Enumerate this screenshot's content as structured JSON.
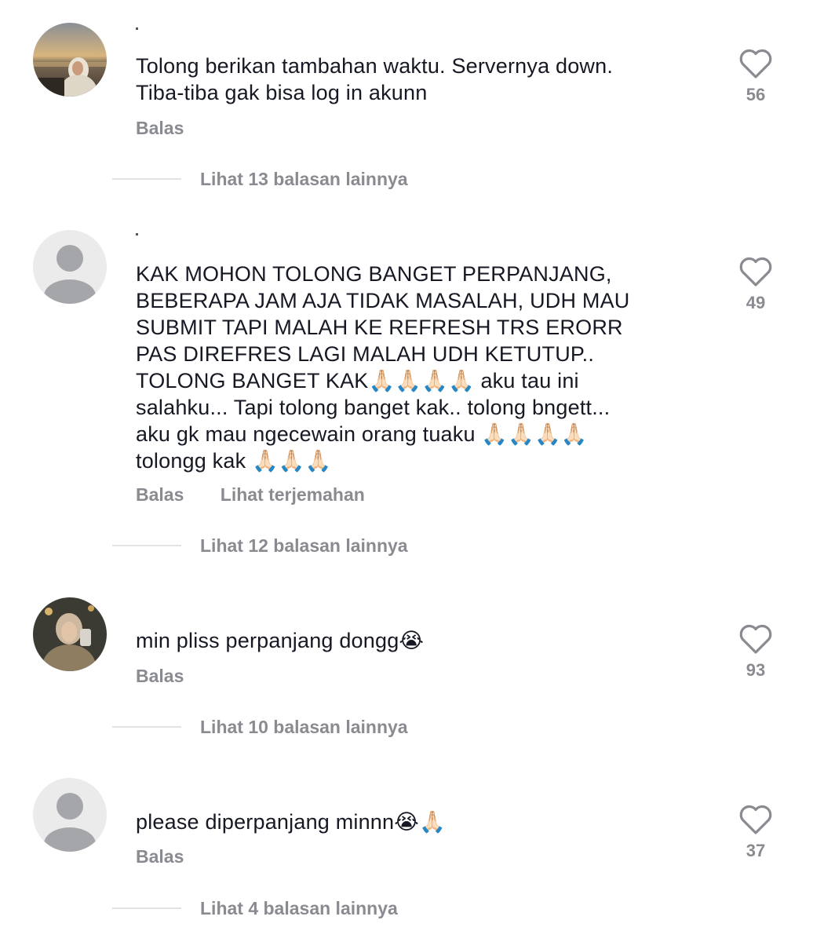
{
  "comments": [
    {
      "text": "Tolong berikan tambahan waktu. Servernya down.\nTiba-tiba gak bisa log in akunn",
      "likes": "56",
      "reply_label": "Balas",
      "more_replies": "Lihat 13 balasan lainnya",
      "avatar": "photo-beach"
    },
    {
      "text": "KAK MOHON TOLONG BANGET PERPANJANG,\nBEBERAPA JAM AJA TIDAK MASALAH, UDH MAU\nSUBMIT TAPI MALAH KE REFRESH TRS ERORR\nPAS DIREFRES LAGI MALAH UDH KETUTUP..\nTOLONG BANGET KAK🙏🏻🙏🏻🙏🏻🙏🏻 aku tau ini\nsalahku... Tapi tolong banget kak.. tolong bngett...\naku gk mau ngecewain orang tuaku 🙏🏻🙏🏻🙏🏻🙏🏻\ntolongg kak 🙏🏻🙏🏻🙏🏻",
      "likes": "49",
      "reply_label": "Balas",
      "translate_label": "Lihat terjemahan",
      "more_replies": "Lihat 12 balasan lainnya",
      "avatar": "default-person"
    },
    {
      "text": "min pliss perpanjang dongg😭",
      "likes": "93",
      "reply_label": "Balas",
      "more_replies": "Lihat 10 balasan lainnya",
      "avatar": "photo-girl"
    },
    {
      "text": "please diperpanjang minnn😭🙏🏻",
      "likes": "37",
      "reply_label": "Balas",
      "more_replies": "Lihat 4 balasan lainnya",
      "avatar": "default-person"
    }
  ],
  "colors": {
    "text": "#161823",
    "muted": "#8a8b91",
    "divider": "#e3e3e4",
    "default_avatar_bg": "#ebebeb",
    "default_avatar_fg": "#a5a6aa"
  }
}
